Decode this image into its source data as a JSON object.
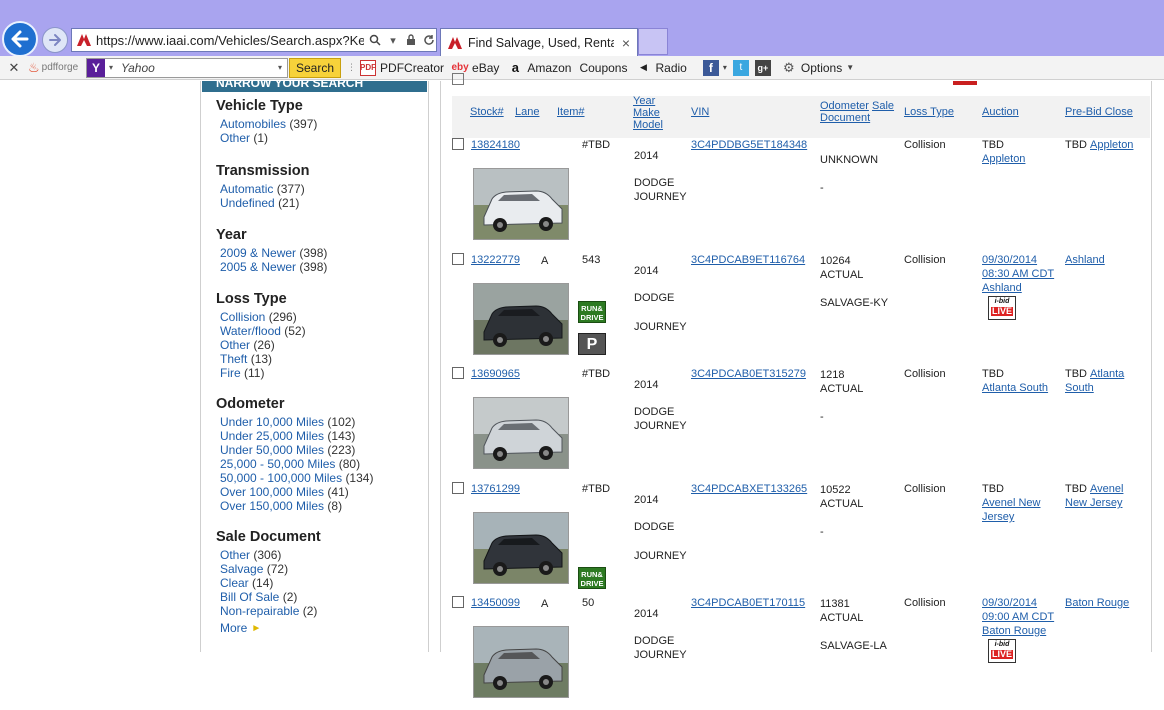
{
  "browser": {
    "address": "https://www.iaai.com/Vehicles/Search.aspx?Keywo",
    "tab_title": "Find Salvage, Used, Rental, ...",
    "tab_close": "×",
    "back_arrow": "←",
    "forward_arrow": "→",
    "toolbar": {
      "close": "✕",
      "pdfforge": "pdfforge",
      "search_placeholder": "Yahoo",
      "search_button": "Search",
      "pdfcreator": "PDFCreator",
      "ebay": "eBay",
      "amazon": "Amazon",
      "coupons": "Coupons",
      "radio": "Radio",
      "options": "Options"
    },
    "icons": {
      "back": "back-arrow-icon",
      "forward": "forward-arrow-icon",
      "search": "search-icon",
      "lock": "lock-icon",
      "refresh": "refresh-icon",
      "facebook": "facebook-icon",
      "twitter": "twitter-icon",
      "googleplus": "google-plus-icon",
      "gear": "gear-icon"
    },
    "colors": {
      "titlebar": "#a9a4ef",
      "back_button": "#1f6fd0",
      "search_button": "#f7d23a"
    }
  },
  "sidebar": {
    "header": "NARROW YOUR SEARCH",
    "groups": [
      {
        "title": "Vehicle Type",
        "items": [
          {
            "label": "Automobiles",
            "count": "(397)"
          },
          {
            "label": "Other",
            "count": "(1)"
          }
        ]
      },
      {
        "title": "Transmission",
        "items": [
          {
            "label": "Automatic",
            "count": "(377)"
          },
          {
            "label": "Undefined",
            "count": "(21)"
          }
        ]
      },
      {
        "title": "Year",
        "items": [
          {
            "label": "2009 & Newer",
            "count": "(398)"
          },
          {
            "label": "2005 & Newer",
            "count": "(398)"
          }
        ]
      },
      {
        "title": "Loss Type",
        "items": [
          {
            "label": "Collision",
            "count": "(296)"
          },
          {
            "label": "Water/flood",
            "count": "(52)"
          },
          {
            "label": "Other",
            "count": "(26)"
          },
          {
            "label": "Theft",
            "count": "(13)"
          },
          {
            "label": "Fire",
            "count": "(11)"
          }
        ]
      },
      {
        "title": "Odometer",
        "items": [
          {
            "label": "Under 10,000 Miles",
            "count": "(102)"
          },
          {
            "label": "Under 25,000 Miles",
            "count": "(143)"
          },
          {
            "label": "Under 50,000 Miles",
            "count": "(223)"
          },
          {
            "label": "25,000 - 50,000 Miles",
            "count": "(80)"
          },
          {
            "label": "50,000 - 100,000 Miles",
            "count": "(134)"
          },
          {
            "label": "Over 100,000 Miles",
            "count": "(41)"
          },
          {
            "label": "Over 150,000 Miles",
            "count": "(8)"
          }
        ]
      },
      {
        "title": "Sale Document",
        "items": [
          {
            "label": "Other",
            "count": "(306)"
          },
          {
            "label": "Salvage",
            "count": "(72)"
          },
          {
            "label": "Clear",
            "count": "(14)"
          },
          {
            "label": "Bill Of Sale",
            "count": "(2)"
          },
          {
            "label": "Non-repairable",
            "count": "(2)"
          }
        ]
      }
    ],
    "more": "More"
  },
  "results": {
    "headers": {
      "stock": "Stock#",
      "lane": "Lane",
      "item": "Item#",
      "ymm1": "Year",
      "ymm2": "Make",
      "ymm3": "Model",
      "vin": "VIN",
      "odo1": "Odometer",
      "odo_sale": "Sale",
      "odo2": "Document",
      "loss": "Loss Type",
      "auction": "Auction",
      "prebid": "Pre-Bid Close"
    },
    "badges": {
      "run_drive_1": "RUN&",
      "run_drive_2": "DRIVE",
      "parking": "P",
      "ibid": "i-bid",
      "live": "LIVE"
    },
    "rows": [
      {
        "stock": "13824180",
        "lane": "",
        "item": "#TBD",
        "year": "2014",
        "make": "DODGE",
        "model": "JOURNEY",
        "model_inline": true,
        "vin": "3C4PDDBG5ET184348",
        "odometer": "UNKNOWN",
        "odo_type": "",
        "document": "-",
        "loss": "Collision",
        "auction_date": "TBD",
        "auction_time": "",
        "auction_loc": "Appleton",
        "prebid_prefix": "TBD",
        "prebid": "Appleton",
        "prebid2": ""
      },
      {
        "stock": "13222779",
        "lane": "A",
        "item": "543",
        "year": "2014",
        "make": "DODGE",
        "model": "JOURNEY",
        "model_inline": false,
        "vin": "3C4PDCAB9ET116764",
        "odometer": "10264",
        "odo_type": "ACTUAL",
        "document": "SALVAGE-KY",
        "loss": "Collision",
        "auction_date": "09/30/2014",
        "auction_time": "08:30 AM CDT",
        "auction_loc": "Ashland",
        "prebid_prefix": "",
        "prebid": "Ashland",
        "prebid2": ""
      },
      {
        "stock": "13690965",
        "lane": "",
        "item": "#TBD",
        "year": "2014",
        "make": "DODGE",
        "model": "JOURNEY",
        "model_inline": true,
        "vin": "3C4PDCAB0ET315279",
        "odometer": "1218",
        "odo_type": "ACTUAL",
        "document": "-",
        "loss": "Collision",
        "auction_date": "TBD",
        "auction_time": "",
        "auction_loc": "Atlanta South",
        "prebid_prefix": "TBD",
        "prebid": "Atlanta",
        "prebid2": "South"
      },
      {
        "stock": "13761299",
        "lane": "",
        "item": "#TBD",
        "year": "2014",
        "make": "DODGE",
        "model": "JOURNEY",
        "model_inline": false,
        "vin": "3C4PDCABXET133265",
        "odometer": "10522",
        "odo_type": "ACTUAL",
        "document": "-",
        "loss": "Collision",
        "auction_date": "TBD",
        "auction_time": "",
        "auction_loc": "Avenel New",
        "auction_loc2": "Jersey",
        "prebid_prefix": "TBD",
        "prebid": "Avenel",
        "prebid2": "New Jersey"
      },
      {
        "stock": "13450099",
        "lane": "A",
        "item": "50",
        "year": "2014",
        "make": "DODGE",
        "model": "JOURNEY",
        "model_inline": true,
        "vin": "3C4PDCAB0ET170115",
        "odometer": "11381",
        "odo_type": "ACTUAL",
        "document": "SALVAGE-LA",
        "loss": "Collision",
        "auction_date": "09/30/2014",
        "auction_time": "09:00 AM CDT",
        "auction_loc": "Baton Rouge",
        "prebid_prefix": "",
        "prebid": "Baton Rouge",
        "prebid2": ""
      }
    ]
  }
}
